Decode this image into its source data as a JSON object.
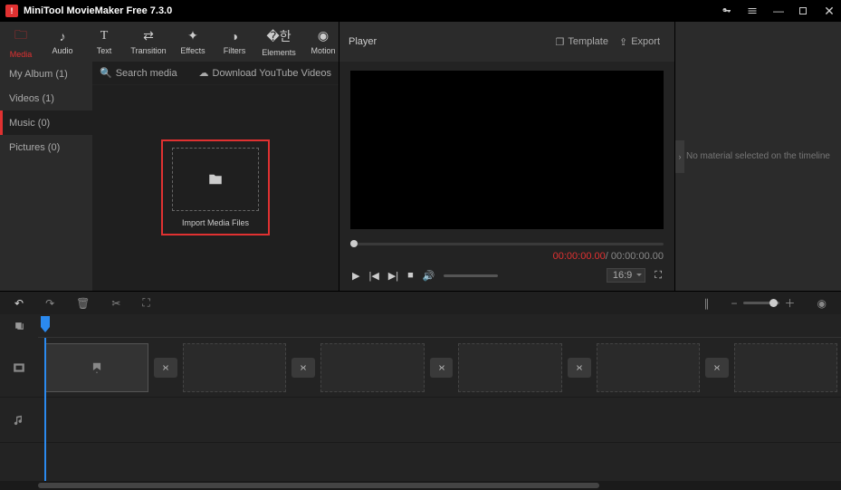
{
  "title": "MiniTool MovieMaker Free 7.3.0",
  "toolbar": [
    {
      "id": "media",
      "label": "Media"
    },
    {
      "id": "audio",
      "label": "Audio"
    },
    {
      "id": "text",
      "label": "Text"
    },
    {
      "id": "transition",
      "label": "Transition"
    },
    {
      "id": "effects",
      "label": "Effects"
    },
    {
      "id": "filters",
      "label": "Filters"
    },
    {
      "id": "elements",
      "label": "Elements"
    },
    {
      "id": "motion",
      "label": "Motion"
    }
  ],
  "sidebar": [
    {
      "label": "My Album (1)"
    },
    {
      "label": "Videos (1)"
    },
    {
      "label": "Music (0)"
    },
    {
      "label": "Pictures (0)"
    }
  ],
  "search_placeholder": "Search media",
  "yt_label": "Download YouTube Videos",
  "import_label": "Import Media Files",
  "player": {
    "title": "Player",
    "template": "Template",
    "export": "Export",
    "current": "00:00:00.00",
    "total": " / 00:00:00.00",
    "ratio": "16:9"
  },
  "right_msg": "No material selected on the timeline"
}
